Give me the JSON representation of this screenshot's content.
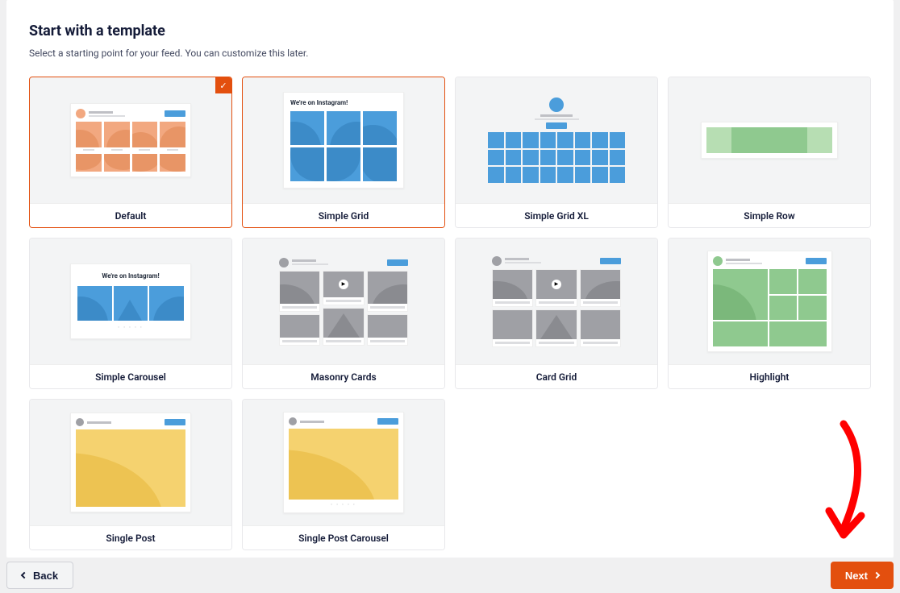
{
  "header": {
    "title": "Start with a template",
    "subtitle": "Select a starting point for your feed. You can customize this later."
  },
  "templates": [
    {
      "label": "Default",
      "selected": true
    },
    {
      "label": "Simple Grid",
      "highlighted": true
    },
    {
      "label": "Simple Grid XL"
    },
    {
      "label": "Simple Row"
    },
    {
      "label": "Simple Carousel"
    },
    {
      "label": "Masonry Cards"
    },
    {
      "label": "Card Grid"
    },
    {
      "label": "Highlight"
    },
    {
      "label": "Single Post"
    },
    {
      "label": "Single Post Carousel"
    }
  ],
  "preview_text": {
    "instagram": "We're on Instagram!"
  },
  "footer": {
    "back": "Back",
    "next": "Next"
  },
  "colors": {
    "accent": "#e34f0e",
    "blue": "#4b9ddb",
    "green": "#8fc98f",
    "orange": "#f2a880",
    "yellow": "#f5d26f",
    "gray": "#9fa0a5"
  }
}
